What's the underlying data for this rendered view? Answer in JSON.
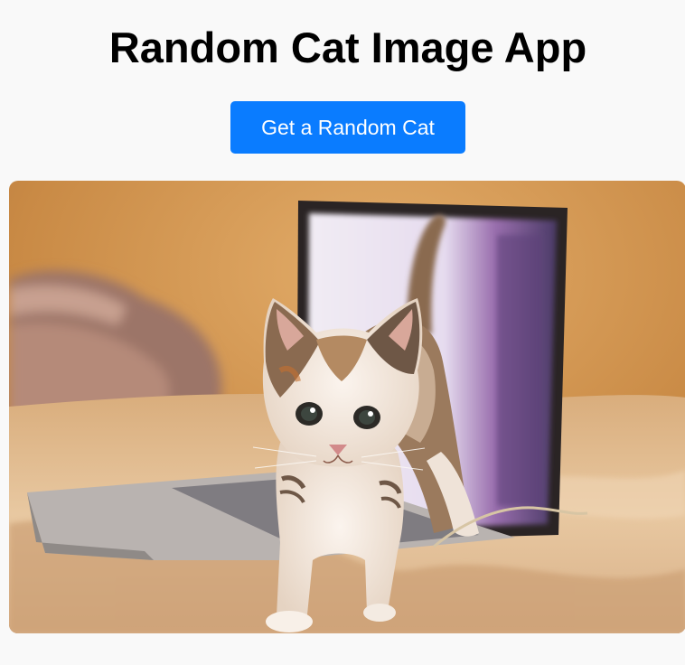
{
  "header": {
    "title": "Random Cat Image App"
  },
  "actions": {
    "random_button_label": "Get a Random Cat"
  },
  "image": {
    "subject": "calico kitten on a bed in front of a laptop",
    "palette": {
      "wall": "#c98a45",
      "bedsheet": "#e6c9a6",
      "laptop_screen": "#e8e0f0",
      "laptop_frame": "#2a2424",
      "kitten_fur": "#f3e9e0",
      "kitten_patch": "#8a6a50"
    }
  }
}
